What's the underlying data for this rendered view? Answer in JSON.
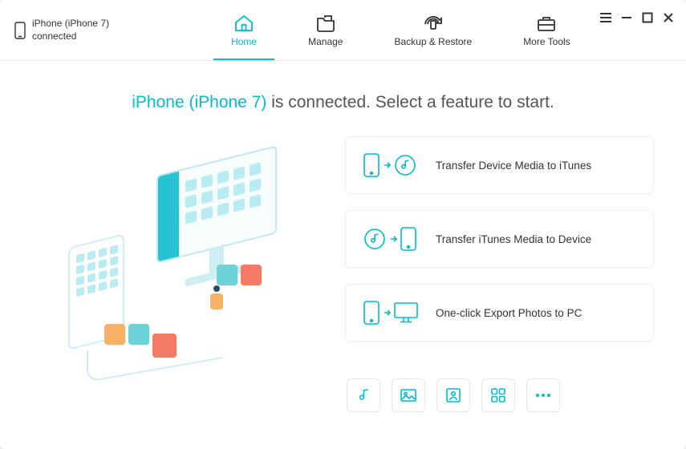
{
  "device": {
    "name": "iPhone (iPhone 7)",
    "status": "connected"
  },
  "tabs": {
    "home": "Home",
    "manage": "Manage",
    "backup": "Backup & Restore",
    "tools": "More Tools"
  },
  "headline": {
    "device": "iPhone (iPhone 7)",
    "text": " is connected. Select a feature to start."
  },
  "features": {
    "deviceToItunes": "Transfer Device Media to iTunes",
    "itunesToDevice": "Transfer iTunes Media to Device",
    "exportPhotos": "One-click Export Photos to PC"
  },
  "shortcuts": {
    "music": "music",
    "pictures": "pictures",
    "contacts": "contacts",
    "apps": "apps",
    "more": "more"
  },
  "colors": {
    "accent": "#00bcd4"
  }
}
